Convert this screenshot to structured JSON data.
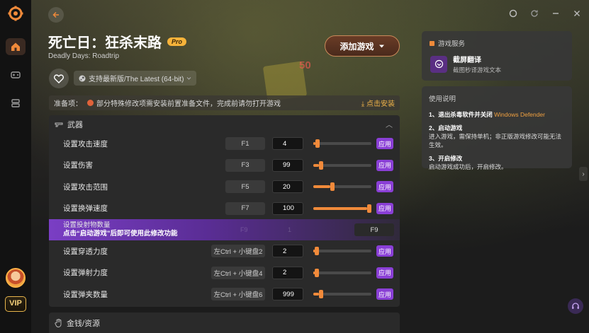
{
  "sidebar": {
    "items": [
      {
        "icon": "home-icon",
        "active": true
      },
      {
        "icon": "gamepad-icon",
        "active": false
      },
      {
        "icon": "stack-icon",
        "active": false
      }
    ],
    "vip_label": "VIP"
  },
  "header": {
    "title": "死亡日：狂杀末路",
    "pro_badge": "Pro",
    "subtitle": "Deadly Days: Roadtrip",
    "add_game_label": "添加游戏",
    "version_label": "支持最新版/The Latest (64-bit)",
    "bg_number": "50"
  },
  "prep": {
    "label": "准备项：",
    "text": "部分特殊修改项需安装前置准备文件，完成前请勿打开游戏",
    "install_label": "点击安装"
  },
  "weapons": {
    "title": "武器",
    "apply_label": "应用",
    "rows": [
      {
        "label": "设置攻击速度",
        "hotkey": "F1",
        "value": "4",
        "level": 0.04
      },
      {
        "label": "设置伤害",
        "hotkey": "F3",
        "value": "99",
        "level": 0.1
      },
      {
        "label": "设置攻击范围",
        "hotkey": "F5",
        "value": "20",
        "level": 0.32
      },
      {
        "label": "设置换弹速度",
        "hotkey": "F7",
        "value": "100",
        "level": 1.0
      }
    ],
    "locked_row": {
      "label": "设置投射物数量",
      "notice": "点击“启动游戏”后即可使用此修改功能",
      "ghost_hotkey": "F9",
      "ghost_value": "1",
      "hotkey": "F9"
    },
    "rows2": [
      {
        "label": "设置穿透力度",
        "hotkey": "左Ctrl + 小键盘2",
        "value": "2",
        "level": 0.02
      },
      {
        "label": "设置弹射力度",
        "hotkey": "左Ctrl + 小键盘4",
        "value": "2",
        "level": 0.02
      },
      {
        "label": "设置弹夹数量",
        "hotkey": "左Ctrl + 小键盘6",
        "value": "999",
        "level": 0.1
      }
    ]
  },
  "money": {
    "title": "金钱/资源"
  },
  "services": {
    "title": "游戏服务",
    "item_name": "截屏翻译",
    "item_desc": "截图秒译游戏文本"
  },
  "guide": {
    "title": "使用说明",
    "step1_title": "1、退出杀毒软件并关闭",
    "step1_highlight": "Windows Defender",
    "step2_title": "2、启动游戏",
    "step2_text": "进入游戏，需保持单机；非正版游戏修改可能无法生效。",
    "step3_title": "3、开启修改",
    "step3_text": "启动游戏成功后，开启修改。"
  },
  "colors": {
    "accent": "#f08a3a",
    "apply": "#8a3fd6",
    "highlight": "#f0a040"
  }
}
